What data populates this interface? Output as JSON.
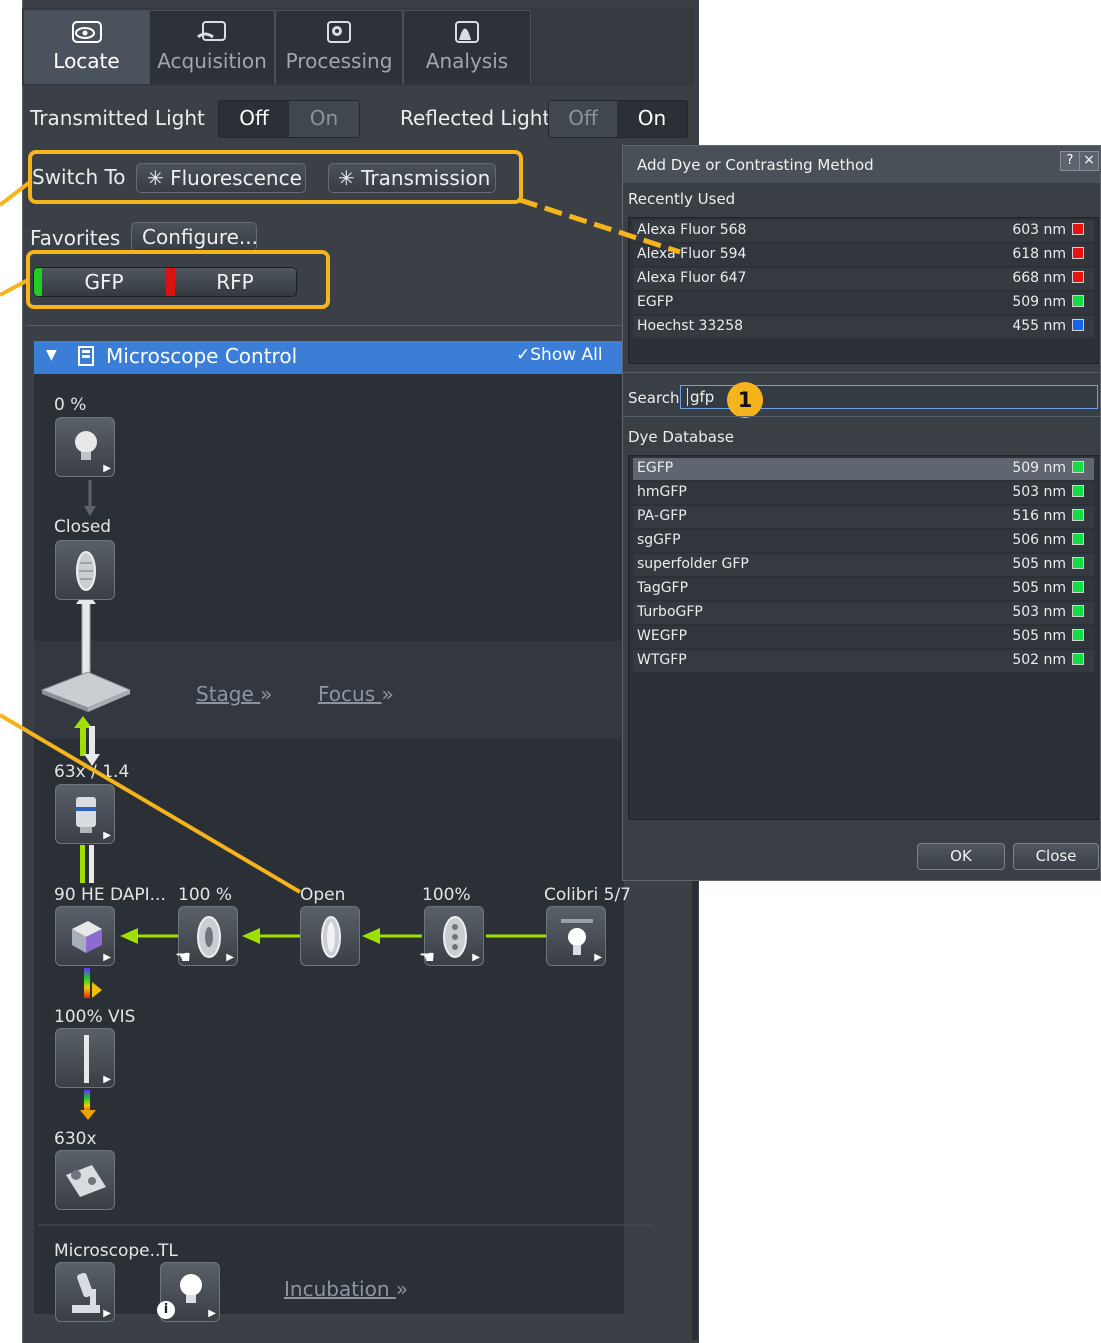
{
  "tabs": [
    {
      "label": "Locate",
      "icon": "eye-icon"
    },
    {
      "label": "Acquisition",
      "icon": "acquisition-icon"
    },
    {
      "label": "Processing",
      "icon": "gear-icon"
    },
    {
      "label": "Analysis",
      "icon": "histogram-icon"
    }
  ],
  "light": {
    "transmitted_label": "Transmitted Light",
    "transmitted_off": "Off",
    "transmitted_on": "On",
    "reflected_label": "Reflected Light",
    "reflected_off": "Off",
    "reflected_on": "On"
  },
  "switch_to": {
    "label": "Switch To",
    "fluorescence": "Fluorescence",
    "transmission": "Transmission"
  },
  "favorites": {
    "label": "Favorites",
    "configure": "Configure...",
    "items": [
      {
        "label": "GFP",
        "color": "#22cc22"
      },
      {
        "label": "RFP",
        "color": "#dd1111"
      }
    ]
  },
  "microscope_control": {
    "title": "Microscope Control",
    "show_all": "Show All",
    "lamp_percent": "0 %",
    "shutter_state": "Closed",
    "stage_link": "Stage",
    "focus_link": "Focus",
    "objective": "63x / 1.4",
    "filter": "90 HE DAPI...",
    "attenuator": "100 %",
    "aperture": "Open",
    "intensity": "100%",
    "light_source": "Colibri 5/7",
    "vis_split": "100% VIS",
    "magnification": "630x",
    "microscope_item": "Microscope...",
    "tl_item": "TL",
    "incubation_link": "Incubation",
    "link_chevron": "»"
  },
  "dialog": {
    "title": "Add Dye or Contrasting Method",
    "help": "?",
    "close_x": "×",
    "recently_used_label": "Recently Used",
    "recently_used": [
      {
        "name": "Alexa Fluor 568",
        "wavelength": "603 nm",
        "color": "#ee1111"
      },
      {
        "name": "Alexa Fluor 594",
        "wavelength": "618 nm",
        "color": "#ee1111"
      },
      {
        "name": "Alexa Fluor 647",
        "wavelength": "668 nm",
        "color": "#ee1111"
      },
      {
        "name": "EGFP",
        "wavelength": "509 nm",
        "color": "#11dd44"
      },
      {
        "name": "Hoechst 33258",
        "wavelength": "455 nm",
        "color": "#1166ee"
      }
    ],
    "search_label": "Search",
    "search_value": "gfp",
    "callout_number": "1",
    "database_label": "Dye Database",
    "database": [
      {
        "name": "EGFP",
        "wavelength": "509 nm",
        "color": "#11dd44"
      },
      {
        "name": "hmGFP",
        "wavelength": "503 nm",
        "color": "#11dd44"
      },
      {
        "name": "PA-GFP",
        "wavelength": "516 nm",
        "color": "#11dd44"
      },
      {
        "name": "sgGFP",
        "wavelength": "506 nm",
        "color": "#11dd44"
      },
      {
        "name": "superfolder GFP",
        "wavelength": "505 nm",
        "color": "#11dd44"
      },
      {
        "name": "TagGFP",
        "wavelength": "505 nm",
        "color": "#11dd44"
      },
      {
        "name": "TurboGFP",
        "wavelength": "503 nm",
        "color": "#11dd44"
      },
      {
        "name": "WEGFP",
        "wavelength": "505 nm",
        "color": "#11dd44"
      },
      {
        "name": "WTGFP",
        "wavelength": "502 nm",
        "color": "#11dd44"
      }
    ],
    "ok_label": "OK",
    "close_label": "Close"
  },
  "colors": {
    "highlight": "#f5b41c",
    "header_blue": "#3a7ed8",
    "light_path": "#9ee000"
  }
}
